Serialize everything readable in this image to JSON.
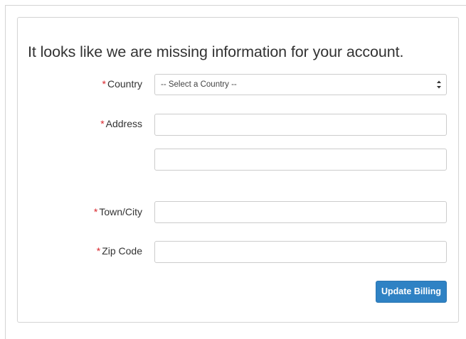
{
  "form": {
    "heading": "It looks like we are missing information for your account.",
    "required_marker": "*",
    "country": {
      "label": "Country",
      "selected": "-- Select a Country --"
    },
    "address": {
      "label": "Address",
      "line1_value": "",
      "line2_value": ""
    },
    "town": {
      "label": "Town/City",
      "value": ""
    },
    "zip": {
      "label": "Zip Code",
      "value": ""
    },
    "submit_label": "Update Billing"
  },
  "colors": {
    "required": "#d9262c",
    "button": "#2f82c4",
    "border": "#cccccc"
  },
  "icons": {
    "select_caret": "updown-caret-icon"
  }
}
